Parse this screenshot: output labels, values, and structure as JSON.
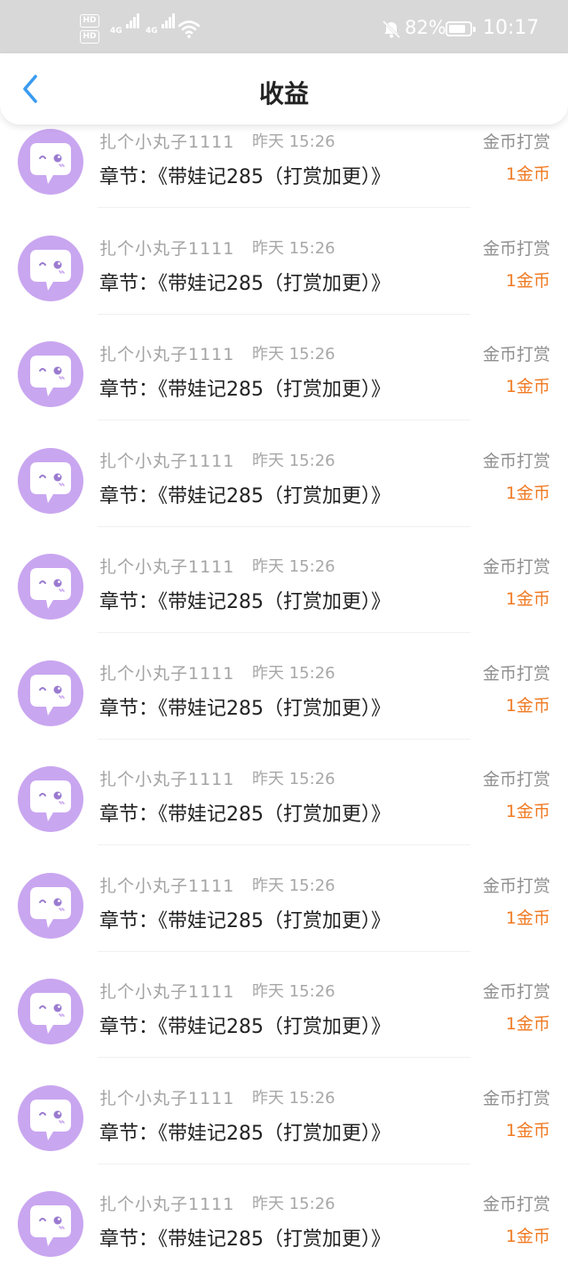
{
  "status_bar": {
    "battery_pct": "82%",
    "battery_level": 0.82,
    "time": "10:17",
    "network_1": "4G",
    "network_2": "4G",
    "hd_1": "HD",
    "hd_2": "HD"
  },
  "navbar": {
    "title": "收益",
    "back_icon": "chevron-left-icon"
  },
  "colors": {
    "accent": "#3a9bf0",
    "avatar_bg": "#c9a6f0",
    "amount": "#f07a22"
  },
  "records": [
    {
      "user": "扎个小丸子1111",
      "time": "昨天 15:26",
      "chapter": "章节：《带娃记285（打赏加更）》",
      "type": "金币打赏",
      "amount": "1金币"
    },
    {
      "user": "扎个小丸子1111",
      "time": "昨天 15:26",
      "chapter": "章节：《带娃记285（打赏加更）》",
      "type": "金币打赏",
      "amount": "1金币"
    },
    {
      "user": "扎个小丸子1111",
      "time": "昨天 15:26",
      "chapter": "章节：《带娃记285（打赏加更）》",
      "type": "金币打赏",
      "amount": "1金币"
    },
    {
      "user": "扎个小丸子1111",
      "time": "昨天 15:26",
      "chapter": "章节：《带娃记285（打赏加更）》",
      "type": "金币打赏",
      "amount": "1金币"
    },
    {
      "user": "扎个小丸子1111",
      "time": "昨天 15:26",
      "chapter": "章节：《带娃记285（打赏加更）》",
      "type": "金币打赏",
      "amount": "1金币"
    },
    {
      "user": "扎个小丸子1111",
      "time": "昨天 15:26",
      "chapter": "章节：《带娃记285（打赏加更）》",
      "type": "金币打赏",
      "amount": "1金币"
    },
    {
      "user": "扎个小丸子1111",
      "time": "昨天 15:26",
      "chapter": "章节：《带娃记285（打赏加更）》",
      "type": "金币打赏",
      "amount": "1金币"
    },
    {
      "user": "扎个小丸子1111",
      "time": "昨天 15:26",
      "chapter": "章节：《带娃记285（打赏加更）》",
      "type": "金币打赏",
      "amount": "1金币"
    },
    {
      "user": "扎个小丸子1111",
      "time": "昨天 15:26",
      "chapter": "章节：《带娃记285（打赏加更）》",
      "type": "金币打赏",
      "amount": "1金币"
    },
    {
      "user": "扎个小丸子1111",
      "time": "昨天 15:26",
      "chapter": "章节：《带娃记285（打赏加更）》",
      "type": "金币打赏",
      "amount": "1金币"
    },
    {
      "user": "扎个小丸子1111",
      "time": "昨天 15:26",
      "chapter": "章节：《带娃记285（打赏加更）》",
      "type": "金币打赏",
      "amount": "1金币"
    }
  ]
}
